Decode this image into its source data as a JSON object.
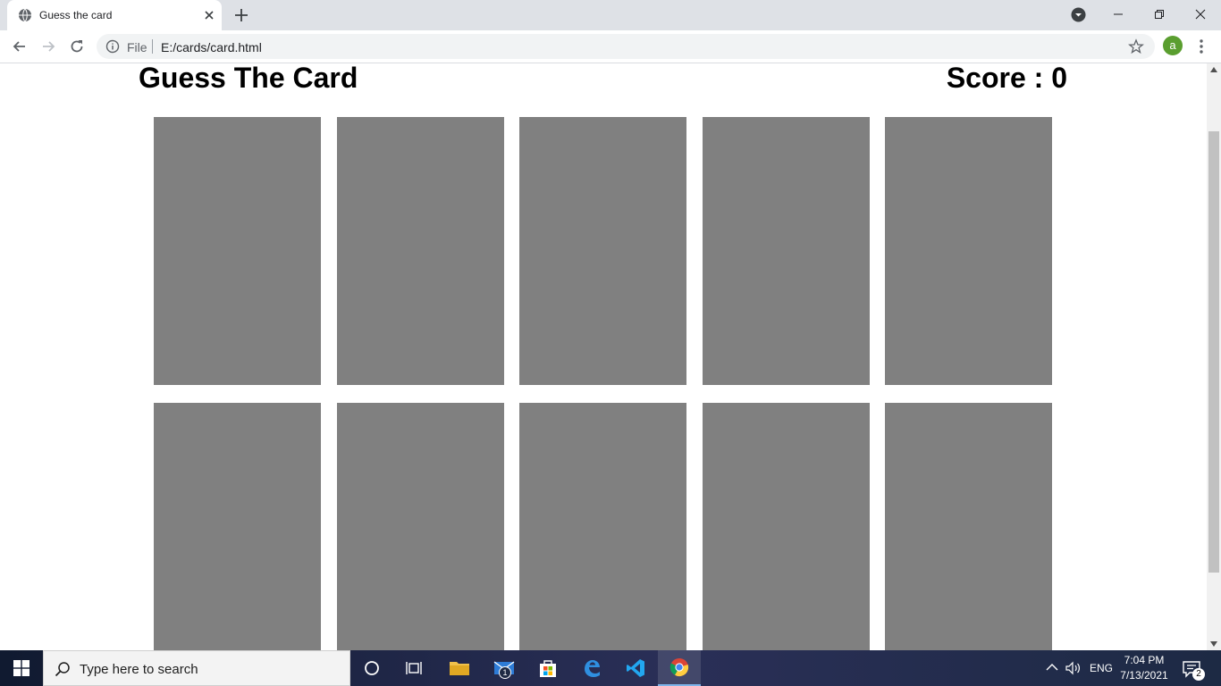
{
  "browser": {
    "tab_title": "Guess the card",
    "url_scheme": "File",
    "url": "E:/cards/card.html",
    "profile_initial": "a"
  },
  "page": {
    "title": "Guess The Card",
    "score_label": "Score : ",
    "score_value": "0",
    "cards": [
      {
        "state": "face-down"
      },
      {
        "state": "face-down"
      },
      {
        "state": "face-down"
      },
      {
        "state": "face-down"
      },
      {
        "state": "face-down"
      },
      {
        "state": "face-down"
      },
      {
        "state": "face-down"
      },
      {
        "state": "face-down"
      },
      {
        "state": "face-down"
      },
      {
        "state": "face-down"
      }
    ],
    "card_color": "#808080"
  },
  "taskbar": {
    "search_placeholder": "Type here to search",
    "mail_badge": "1",
    "language": "ENG",
    "time": "7:04 PM",
    "date": "7/13/2021",
    "notification_count": "2",
    "icons": [
      "windows-start-icon",
      "cortana-icon",
      "task-view-icon",
      "file-explorer-icon",
      "mail-icon",
      "store-icon",
      "edge-icon",
      "vscode-icon",
      "chrome-icon"
    ]
  }
}
